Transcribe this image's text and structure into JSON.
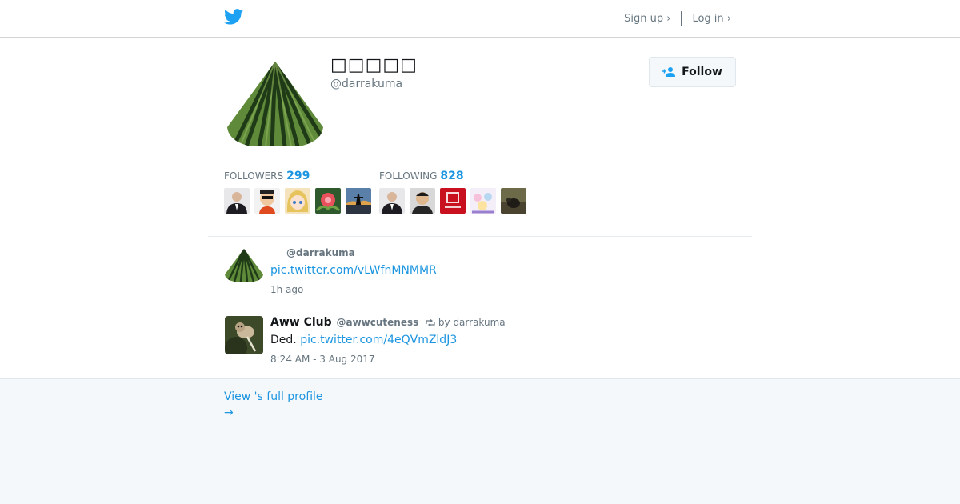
{
  "header": {
    "logo_icon": "twitter-bird-icon",
    "signup_label": "Sign up ›",
    "login_label": "Log in ›",
    "brand_color": "#1da1f2"
  },
  "profile": {
    "display_name": "□□□□□",
    "screen_name": "@darrakuma",
    "follow_label": "Follow",
    "followers_label": "FOLLOWERS",
    "followers_count": "299",
    "following_label": "FOLLOWING",
    "following_count": "828"
  },
  "tweets": [
    {
      "name": "",
      "handle": "@darrakuma",
      "retweet_by": "",
      "text_prefix": "",
      "link": "pic.twitter.com/vLWfnMNMMR",
      "time": "1h ago"
    },
    {
      "name": "Aww Club",
      "handle": "@awwcuteness",
      "retweet_by": "by darrakuma",
      "text_prefix": "Ded. ",
      "link": "pic.twitter.com/4eQVmZldJ3",
      "time": "8:24 AM - 3 Aug 2017"
    }
  ],
  "footer": {
    "view_profile_label": "View 's full profile",
    "arrow": "→"
  },
  "colors": {
    "link": "#1b95e0",
    "muted": "#66757f"
  }
}
